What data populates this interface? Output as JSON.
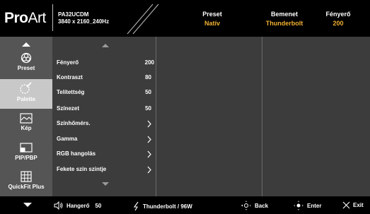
{
  "brand": {
    "logo_pro": "Pro",
    "logo_art": "Art"
  },
  "model": {
    "name": "PA32UCDM",
    "resolution": "3840 x 2160_240Hz"
  },
  "status": [
    {
      "label": "Preset",
      "value": "Natív"
    },
    {
      "label": "Bemenet",
      "value": "Thunderbolt"
    },
    {
      "label": "Fényerő",
      "value": "200"
    }
  ],
  "tabs": [
    {
      "label": "Preset",
      "icon": "palette-icon"
    },
    {
      "label": "Palette",
      "icon": "color-wand-icon",
      "active": true
    },
    {
      "label": "Kép",
      "icon": "image-icon"
    },
    {
      "label": "PIP/PBP",
      "icon": "pip-icon"
    },
    {
      "label": "QuickFit Plus",
      "icon": "grid-icon"
    }
  ],
  "menu": {
    "items": [
      {
        "label": "Fényerő",
        "value": "200"
      },
      {
        "label": "Kontraszt",
        "value": "80"
      },
      {
        "label": "Telítettség",
        "value": "50"
      },
      {
        "label": "Színezet",
        "value": "50"
      },
      {
        "label": "Színhőmérs.",
        "value": ""
      },
      {
        "label": "Gamma",
        "value": ""
      },
      {
        "label": "RGB hangolás",
        "value": ""
      },
      {
        "label": "Fekete szín szintje",
        "value": ""
      }
    ]
  },
  "footer": {
    "volume_label": "Hangerő",
    "volume_value": "50",
    "input": "Thunderbolt / 96W",
    "back": "Back",
    "enter": "Enter",
    "exit": "Exit"
  },
  "colors": {
    "accent": "#f0b030",
    "panel": "#3c3c3c",
    "tabs": "#555555",
    "active_tab": "#c8c8c8"
  }
}
